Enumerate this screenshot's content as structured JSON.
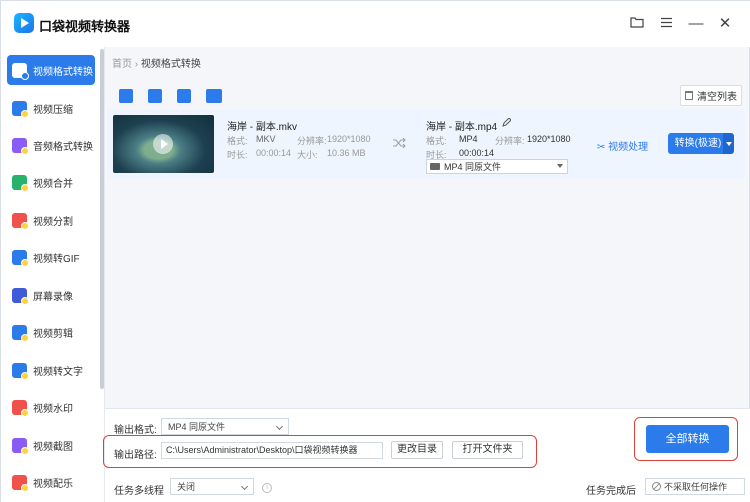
{
  "app": {
    "title": "口袋视频转换器"
  },
  "window": {
    "folder_icon": "folder-icon",
    "menu_icon": "menu-icon",
    "minimize": "—",
    "close": "✕"
  },
  "sidebar": {
    "items": [
      {
        "label": "视频格式转换",
        "icon": "video-convert-icon",
        "color": "#2c7bea",
        "active": true
      },
      {
        "label": "视频压缩",
        "icon": "compress-icon",
        "color": "#2c7bea"
      },
      {
        "label": "音频格式转换",
        "icon": "audio-icon",
        "color": "#8a5cf6"
      },
      {
        "label": "视频合并",
        "icon": "merge-icon",
        "color": "#27b36b"
      },
      {
        "label": "视频分割",
        "icon": "split-icon",
        "color": "#f0514a"
      },
      {
        "label": "视频转GIF",
        "icon": "gif-icon",
        "color": "#2c7bea"
      },
      {
        "label": "屏幕录像",
        "icon": "record-icon",
        "color": "#3f5bd8"
      },
      {
        "label": "视频剪辑",
        "icon": "edit-icon",
        "color": "#2c7bea"
      },
      {
        "label": "视频转文字",
        "icon": "text-icon",
        "color": "#2c7bea"
      },
      {
        "label": "视频水印",
        "icon": "watermark-icon",
        "color": "#f0514a"
      },
      {
        "label": "视频截图",
        "icon": "screenshot-icon",
        "color": "#8a5cf6"
      },
      {
        "label": "视频配乐",
        "icon": "music-icon",
        "color": "#f0514a"
      }
    ]
  },
  "breadcrumb": {
    "home": "首页",
    "separator": "›",
    "current": "视频格式转换"
  },
  "toolbar": {
    "clear_label": "清空列表"
  },
  "file": {
    "source_name": "海岸 - 副本.mkv",
    "source_format_label": "格式:",
    "source_format": "MKV",
    "source_res_label": "分辨率:",
    "source_res": "1920*1080",
    "source_duration_label": "时长:",
    "source_duration": "00:00:14",
    "source_size_label": "大小:",
    "source_size": "10.36 MB",
    "target_name": "海岸 - 副本.mp4",
    "target_format_label": "格式:",
    "target_format": "MP4",
    "target_res_label": "分辨率:",
    "target_res": "1920*1080",
    "target_duration_label": "时长:",
    "target_duration": "00:00:14",
    "target_select": "MP4  同原文件",
    "video_process": "视频处理",
    "convert_label": "转换(极速)"
  },
  "bottom": {
    "output_format_label": "输出格式:",
    "output_format_value": "MP4  同原文件",
    "output_path_label": "输出路径:",
    "output_path_value": "C:\\Users\\Administrator\\Desktop\\口袋视频转换器",
    "change_dir": "更改目录",
    "open_folder": "打开文件夹",
    "convert_all": "全部转换",
    "multithread_label": "任务多线程",
    "multithread_value": "关闭",
    "after_done_label": "任务完成后",
    "after_done_value": "不采取任何操作"
  },
  "colors": {
    "accent": "#2c7bea",
    "highlight": "#e0403a"
  }
}
